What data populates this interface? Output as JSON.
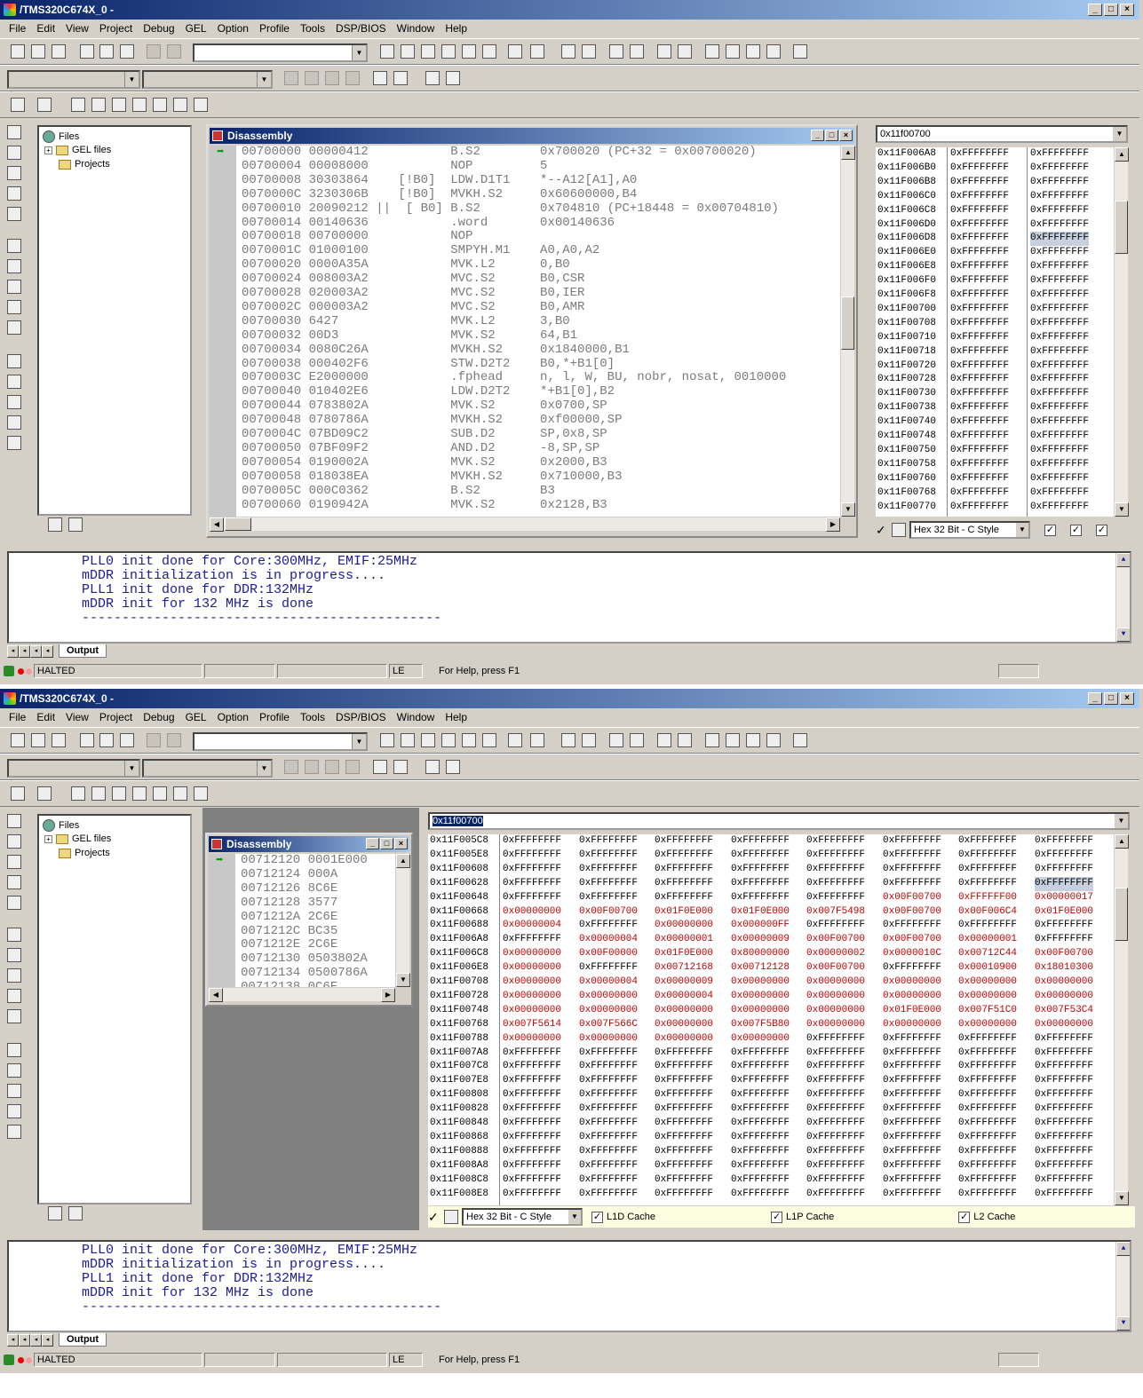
{
  "window": {
    "title": "/TMS320C674X_0 -",
    "buttons": [
      "_",
      "□",
      "×"
    ]
  },
  "menu": [
    "File",
    "Edit",
    "View",
    "Project",
    "Debug",
    "GEL",
    "Option",
    "Profile",
    "Tools",
    "DSP/BIOS",
    "Window",
    "Help"
  ],
  "project_tree": {
    "root": "Files",
    "items": [
      "GEL files",
      "Projects"
    ]
  },
  "shot1": {
    "disassembly": {
      "title": "Disassembly",
      "lines": [
        "00700000 00000412           B.S2        0x700020 (PC+32 = 0x00700020)",
        "00700004 00008000           NOP         5",
        "00700008 30303864    [!B0]  LDW.D1T1    *--A12[A1],A0",
        "0070000C 3230306B    [!B0]  MVKH.S2     0x60600000,B4",
        "00700010 20090212 ||  [ B0] B.S2        0x704810 (PC+18448 = 0x00704810)",
        "00700014 00140636           .word       0x00140636",
        "00700018 00700000           NOP",
        "0070001C 01000100           SMPYH.M1    A0,A0,A2",
        "00700020 0000A35A           MVK.L2      0,B0",
        "00700024 008003A2           MVC.S2      B0,CSR",
        "00700028 020003A2           MVC.S2      B0,IER",
        "0070002C 000003A2           MVC.S2      B0,AMR",
        "00700030 6427               MVK.L2      3,B0",
        "00700032 00D3               MVK.S2      64,B1",
        "00700034 0080C26A           MVKH.S2     0x1840000,B1",
        "00700038 000402F6           STW.D2T2    B0,*+B1[0]",
        "0070003C E2000000           .fphead     n, l, W, BU, nobr, nosat, 0010000",
        "00700040 010402E6           LDW.D2T2    *+B1[0],B2",
        "00700044 0783802A           MVK.S2      0x0700,SP",
        "00700048 0780786A           MVKH.S2     0xf00000,SP",
        "0070004C 07BD09C2           SUB.D2      SP,0x8,SP",
        "00700050 07BF09F2           AND.D2      -8,SP,SP",
        "00700054 0190002A           MVK.S2      0x2000,B3",
        "00700058 018038EA           MVKH.S2     0x710000,B3",
        "0070005C 000C0362           B.S2        B3",
        "00700060 0190942A           MVK.S2      0x2128,B3"
      ]
    },
    "memory": {
      "address": "0x11f00700",
      "format": "Hex 32 Bit - C Style",
      "rows": [
        [
          "0x11F006A8",
          "0xFFFFFFFF",
          "0xFFFFFFFF"
        ],
        [
          "0x11F006B0",
          "0xFFFFFFFF",
          "0xFFFFFFFF"
        ],
        [
          "0x11F006B8",
          "0xFFFFFFFF",
          "0xFFFFFFFF"
        ],
        [
          "0x11F006C0",
          "0xFFFFFFFF",
          "0xFFFFFFFF"
        ],
        [
          "0x11F006C8",
          "0xFFFFFFFF",
          "0xFFFFFFFF"
        ],
        [
          "0x11F006D0",
          "0xFFFFFFFF",
          "0xFFFFFFFF"
        ],
        [
          "0x11F006D8",
          "0xFFFFFFFF",
          "0xFFFFFFFF"
        ],
        [
          "0x11F006E0",
          "0xFFFFFFFF",
          "0xFFFFFFFF"
        ],
        [
          "0x11F006E8",
          "0xFFFFFFFF",
          "0xFFFFFFFF"
        ],
        [
          "0x11F006F0",
          "0xFFFFFFFF",
          "0xFFFFFFFF"
        ],
        [
          "0x11F006F8",
          "0xFFFFFFFF",
          "0xFFFFFFFF"
        ],
        [
          "0x11F00700",
          "0xFFFFFFFF",
          "0xFFFFFFFF"
        ],
        [
          "0x11F00708",
          "0xFFFFFFFF",
          "0xFFFFFFFF"
        ],
        [
          "0x11F00710",
          "0xFFFFFFFF",
          "0xFFFFFFFF"
        ],
        [
          "0x11F00718",
          "0xFFFFFFFF",
          "0xFFFFFFFF"
        ],
        [
          "0x11F00720",
          "0xFFFFFFFF",
          "0xFFFFFFFF"
        ],
        [
          "0x11F00728",
          "0xFFFFFFFF",
          "0xFFFFFFFF"
        ],
        [
          "0x11F00730",
          "0xFFFFFFFF",
          "0xFFFFFFFF"
        ],
        [
          "0x11F00738",
          "0xFFFFFFFF",
          "0xFFFFFFFF"
        ],
        [
          "0x11F00740",
          "0xFFFFFFFF",
          "0xFFFFFFFF"
        ],
        [
          "0x11F00748",
          "0xFFFFFFFF",
          "0xFFFFFFFF"
        ],
        [
          "0x11F00750",
          "0xFFFFFFFF",
          "0xFFFFFFFF"
        ],
        [
          "0x11F00758",
          "0xFFFFFFFF",
          "0xFFFFFFFF"
        ],
        [
          "0x11F00760",
          "0xFFFFFFFF",
          "0xFFFFFFFF"
        ],
        [
          "0x11F00768",
          "0xFFFFFFFF",
          "0xFFFFFFFF"
        ],
        [
          "0x11F00770",
          "0xFFFFFFFF",
          "0xFFFFFFFF"
        ]
      ]
    }
  },
  "shot2": {
    "disassembly": {
      "title": "Disassembly",
      "lines": [
        "00712120 0001E000",
        "00712124 000A",
        "00712126 8C6E",
        "00712128 3577",
        "0071212A 2C6E",
        "0071212C BC35",
        "0071212E 2C6E",
        "00712130 0503802A",
        "00712134 0500786A",
        "00712138 0C6E"
      ]
    },
    "memory": {
      "address": "0x11f00700",
      "format": "Hex 32 Bit - C Style",
      "cache_labels": [
        "L1D Cache",
        "L1P Cache",
        "L2 Cache"
      ],
      "rows": [
        [
          "0x11F005C8",
          "0xFFFFFFFF",
          "0xFFFFFFFF",
          "0xFFFFFFFF",
          "0xFFFFFFFF",
          "0xFFFFFFFF",
          "0xFFFFFFFF",
          "0xFFFFFFFF",
          "0xFFFFFFFF"
        ],
        [
          "0x11F005E8",
          "0xFFFFFFFF",
          "0xFFFFFFFF",
          "0xFFFFFFFF",
          "0xFFFFFFFF",
          "0xFFFFFFFF",
          "0xFFFFFFFF",
          "0xFFFFFFFF",
          "0xFFFFFFFF"
        ],
        [
          "0x11F00608",
          "0xFFFFFFFF",
          "0xFFFFFFFF",
          "0xFFFFFFFF",
          "0xFFFFFFFF",
          "0xFFFFFFFF",
          "0xFFFFFFFF",
          "0xFFFFFFFF",
          "0xFFFFFFFF"
        ],
        [
          "0x11F00628",
          "0xFFFFFFFF",
          "0xFFFFFFFF",
          "0xFFFFFFFF",
          "0xFFFFFFFF",
          "0xFFFFFFFF",
          "0xFFFFFFFF",
          "0xFFFFFFFF",
          "0xFFFFFFFF"
        ],
        [
          "0x11F00648",
          "0xFFFFFFFF",
          "0xFFFFFFFF",
          "0xFFFFFFFF",
          "0xFFFFFFFF",
          "0xFFFFFFFF",
          "0x00F00700",
          "0xFFFFFF00",
          "0x00000017"
        ],
        [
          "0x11F00668",
          "0x00000000",
          "0x00F00700",
          "0x01F0E000",
          "0x01F0E000",
          "0x007F5498",
          "0x00F00700",
          "0x00F006C4",
          "0x01F0E000"
        ],
        [
          "0x11F00688",
          "0x00000004",
          "0xFFFFFFFF",
          "0x00000000",
          "0x000000FF",
          "0xFFFFFFFF",
          "0xFFFFFFFF",
          "0xFFFFFFFF",
          "0xFFFFFFFF"
        ],
        [
          "0x11F006A8",
          "0xFFFFFFFF",
          "0x00000004",
          "0x00000001",
          "0x00000009",
          "0x00F00700",
          "0x00F00700",
          "0x00000001",
          "0xFFFFFFFF"
        ],
        [
          "0x11F006C8",
          "0x00000000",
          "0x00F00000",
          "0x01F0E000",
          "0x80000000",
          "0x00000002",
          "0x0000010C",
          "0x00712C44",
          "0x00F00700"
        ],
        [
          "0x11F006E8",
          "0x00000000",
          "0xFFFFFFFF",
          "0x00712168",
          "0x00712128",
          "0x00F00700",
          "0xFFFFFFFF",
          "0x00010900",
          "0x18010300"
        ],
        [
          "0x11F00708",
          "0x00000000",
          "0x00000004",
          "0x00000009",
          "0x00000000",
          "0x00000000",
          "0x00000000",
          "0x00000000",
          "0x00000000"
        ],
        [
          "0x11F00728",
          "0x00000000",
          "0x00000000",
          "0x00000004",
          "0x00000000",
          "0x00000000",
          "0x00000000",
          "0x00000000",
          "0x00000000"
        ],
        [
          "0x11F00748",
          "0x00000000",
          "0x00000000",
          "0x00000000",
          "0x00000000",
          "0x00000000",
          "0x01F0E000",
          "0x007F51C0",
          "0x007F53C4"
        ],
        [
          "0x11F00768",
          "0x007F5614",
          "0x007F566C",
          "0x00000000",
          "0x007F5B80",
          "0x00000000",
          "0x00000000",
          "0x00000000",
          "0x00000000"
        ],
        [
          "0x11F00788",
          "0x00000000",
          "0x00000000",
          "0x00000000",
          "0x00000000",
          "0xFFFFFFFF",
          "0xFFFFFFFF",
          "0xFFFFFFFF",
          "0xFFFFFFFF"
        ],
        [
          "0x11F007A8",
          "0xFFFFFFFF",
          "0xFFFFFFFF",
          "0xFFFFFFFF",
          "0xFFFFFFFF",
          "0xFFFFFFFF",
          "0xFFFFFFFF",
          "0xFFFFFFFF",
          "0xFFFFFFFF"
        ],
        [
          "0x11F007C8",
          "0xFFFFFFFF",
          "0xFFFFFFFF",
          "0xFFFFFFFF",
          "0xFFFFFFFF",
          "0xFFFFFFFF",
          "0xFFFFFFFF",
          "0xFFFFFFFF",
          "0xFFFFFFFF"
        ],
        [
          "0x11F007E8",
          "0xFFFFFFFF",
          "0xFFFFFFFF",
          "0xFFFFFFFF",
          "0xFFFFFFFF",
          "0xFFFFFFFF",
          "0xFFFFFFFF",
          "0xFFFFFFFF",
          "0xFFFFFFFF"
        ],
        [
          "0x11F00808",
          "0xFFFFFFFF",
          "0xFFFFFFFF",
          "0xFFFFFFFF",
          "0xFFFFFFFF",
          "0xFFFFFFFF",
          "0xFFFFFFFF",
          "0xFFFFFFFF",
          "0xFFFFFFFF"
        ],
        [
          "0x11F00828",
          "0xFFFFFFFF",
          "0xFFFFFFFF",
          "0xFFFFFFFF",
          "0xFFFFFFFF",
          "0xFFFFFFFF",
          "0xFFFFFFFF",
          "0xFFFFFFFF",
          "0xFFFFFFFF"
        ],
        [
          "0x11F00848",
          "0xFFFFFFFF",
          "0xFFFFFFFF",
          "0xFFFFFFFF",
          "0xFFFFFFFF",
          "0xFFFFFFFF",
          "0xFFFFFFFF",
          "0xFFFFFFFF",
          "0xFFFFFFFF"
        ],
        [
          "0x11F00868",
          "0xFFFFFFFF",
          "0xFFFFFFFF",
          "0xFFFFFFFF",
          "0xFFFFFFFF",
          "0xFFFFFFFF",
          "0xFFFFFFFF",
          "0xFFFFFFFF",
          "0xFFFFFFFF"
        ],
        [
          "0x11F00888",
          "0xFFFFFFFF",
          "0xFFFFFFFF",
          "0xFFFFFFFF",
          "0xFFFFFFFF",
          "0xFFFFFFFF",
          "0xFFFFFFFF",
          "0xFFFFFFFF",
          "0xFFFFFFFF"
        ],
        [
          "0x11F008A8",
          "0xFFFFFFFF",
          "0xFFFFFFFF",
          "0xFFFFFFFF",
          "0xFFFFFFFF",
          "0xFFFFFFFF",
          "0xFFFFFFFF",
          "0xFFFFFFFF",
          "0xFFFFFFFF"
        ],
        [
          "0x11F008C8",
          "0xFFFFFFFF",
          "0xFFFFFFFF",
          "0xFFFFFFFF",
          "0xFFFFFFFF",
          "0xFFFFFFFF",
          "0xFFFFFFFF",
          "0xFFFFFFFF",
          "0xFFFFFFFF"
        ],
        [
          "0x11F008E8",
          "0xFFFFFFFF",
          "0xFFFFFFFF",
          "0xFFFFFFFF",
          "0xFFFFFFFF",
          "0xFFFFFFFF",
          "0xFFFFFFFF",
          "0xFFFFFFFF",
          "0xFFFFFFFF"
        ]
      ]
    }
  },
  "output": {
    "tab": "Output",
    "lines": [
      "PLL0 init done for Core:300MHz, EMIF:25MHz",
      "mDDR initialization is in progress....",
      "PLL1 init done for DDR:132MHz",
      "mDDR init for 132 MHz is done",
      "---------------------------------------------"
    ]
  },
  "status": {
    "state": "HALTED",
    "endian": "LE",
    "help": "For Help, press F1"
  },
  "colors": {
    "titlebar_start": "#0a246a",
    "titlebar_end": "#a6caf0",
    "changed_memory": "#c00000",
    "output_text": "#1a1aa0",
    "disassembly_text": "#7a7a7a"
  }
}
